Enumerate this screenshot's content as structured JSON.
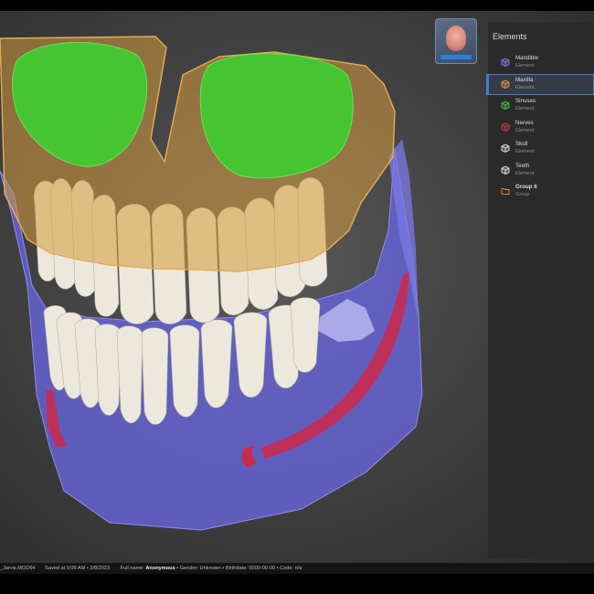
{
  "panel": {
    "title": "Elements",
    "items": [
      {
        "name": "Mandible",
        "sub": "Element",
        "icon": "cube-icon",
        "color": "#8a84e8"
      },
      {
        "name": "Maxilla",
        "sub": "Element",
        "icon": "cube-icon",
        "color": "#e6a03a"
      },
      {
        "name": "Sinuses",
        "sub": "Element",
        "icon": "cube-icon",
        "color": "#3ecf3e"
      },
      {
        "name": "Nerves",
        "sub": "Element",
        "icon": "cube-icon",
        "color": "#d8373c"
      },
      {
        "name": "Skull",
        "sub": "Element",
        "icon": "cube-icon",
        "color": "#e8e8e8"
      },
      {
        "name": "Teeth",
        "sub": "Element",
        "icon": "cube-icon",
        "color": "#e8e8e8"
      },
      {
        "name": "Group 6",
        "sub": "Group",
        "icon": "folder-icon",
        "color": "#e08a3a"
      }
    ],
    "selected_index": 1
  },
  "status": {
    "file": "_Jarvis.MOD64",
    "saved": "Saved at 9:06 AM • 3/8/2023",
    "fullname_label": "Full name:",
    "fullname_value": "Anonymous",
    "rest": "• Gender: Unknown • Birthdate: 0000-00-00 • Code: n/a"
  },
  "colors": {
    "accent": "#3d7fd1",
    "mandible": "#6e6be0",
    "maxilla": "#d69a3c",
    "sinuses": "#46c93a",
    "nerves": "#c92b4e",
    "teeth": "#ece8dc"
  }
}
